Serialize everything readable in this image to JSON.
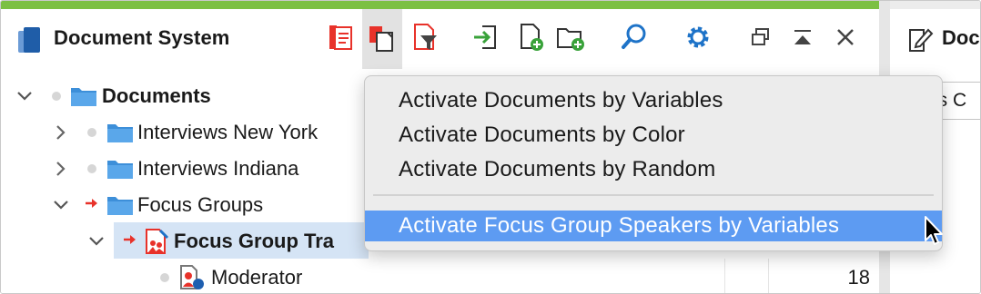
{
  "window": {
    "title": "Document System",
    "accent_color": "#7cc043",
    "right_panel_title": "Doc",
    "right_panel_input_text": "us C"
  },
  "toolbar": {
    "buttons": [
      {
        "name": "activate-documents-icon",
        "color": "#e8322a"
      },
      {
        "name": "activate-by-options-icon",
        "color": "#e8322a"
      },
      {
        "name": "filter-documents-icon",
        "color": "#e8322a"
      },
      {
        "name": "import-icon",
        "color": "#39a23a"
      },
      {
        "name": "new-document-icon",
        "color": "#39a23a"
      },
      {
        "name": "new-folder-icon",
        "color": "#39a23a"
      },
      {
        "name": "search-icon",
        "color": "#1e73c8"
      },
      {
        "name": "gear-icon",
        "color": "#1e73c8"
      }
    ],
    "window_controls": [
      "undock-icon",
      "collapse-icon",
      "close-icon"
    ]
  },
  "tree": {
    "root": {
      "label": "Documents"
    },
    "items": [
      {
        "label": "Interviews New York",
        "expanded": false
      },
      {
        "label": "Interviews Indiana",
        "expanded": false
      },
      {
        "label": "Focus Groups",
        "expanded": true
      },
      {
        "label": "Focus Group Tra",
        "expanded": true
      },
      {
        "label": "Moderator",
        "count": "18"
      }
    ]
  },
  "menu": {
    "items": [
      "Activate Documents by Variables",
      "Activate Documents by Color",
      "Activate Documents by Random"
    ],
    "highlighted_item": "Activate Focus Group Speakers by Variables",
    "highlight_color": "#5d9bf2"
  }
}
